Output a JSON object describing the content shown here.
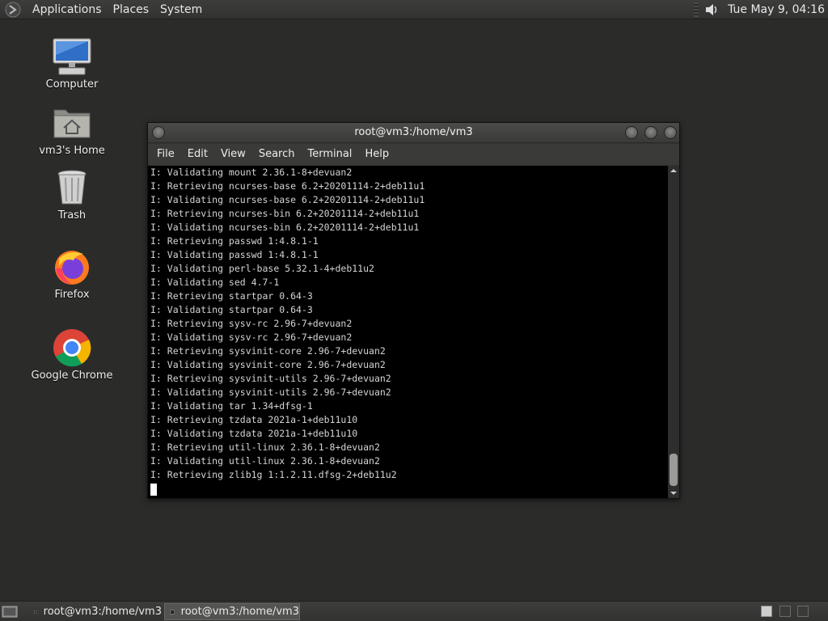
{
  "top_panel": {
    "menus": [
      "Applications",
      "Places",
      "System"
    ],
    "clock": "Tue May  9, 04:16"
  },
  "desktop": {
    "icons": [
      {
        "label": "Computer"
      },
      {
        "label": "vm3's Home"
      },
      {
        "label": "Trash"
      },
      {
        "label": "Firefox"
      },
      {
        "label": "Google Chrome"
      }
    ]
  },
  "terminal": {
    "title": "root@vm3:/home/vm3",
    "menu": [
      "File",
      "Edit",
      "View",
      "Search",
      "Terminal",
      "Help"
    ],
    "lines": [
      "I: Validating mount 2.36.1-8+devuan2",
      "I: Retrieving ncurses-base 6.2+20201114-2+deb11u1",
      "I: Validating ncurses-base 6.2+20201114-2+deb11u1",
      "I: Retrieving ncurses-bin 6.2+20201114-2+deb11u1",
      "I: Validating ncurses-bin 6.2+20201114-2+deb11u1",
      "I: Retrieving passwd 1:4.8.1-1",
      "I: Validating passwd 1:4.8.1-1",
      "I: Validating perl-base 5.32.1-4+deb11u2",
      "I: Validating sed 4.7-1",
      "I: Retrieving startpar 0.64-3",
      "I: Validating startpar 0.64-3",
      "I: Retrieving sysv-rc 2.96-7+devuan2",
      "I: Validating sysv-rc 2.96-7+devuan2",
      "I: Retrieving sysvinit-core 2.96-7+devuan2",
      "I: Validating sysvinit-core 2.96-7+devuan2",
      "I: Retrieving sysvinit-utils 2.96-7+devuan2",
      "I: Validating sysvinit-utils 2.96-7+devuan2",
      "I: Validating tar 1.34+dfsg-1",
      "I: Retrieving tzdata 2021a-1+deb11u10",
      "I: Validating tzdata 2021a-1+deb11u10",
      "I: Retrieving util-linux 2.36.1-8+devuan2",
      "I: Validating util-linux 2.36.1-8+devuan2",
      "I: Retrieving zlib1g 1:1.2.11.dfsg-2+deb11u2"
    ]
  },
  "taskbar": {
    "tasks": [
      {
        "label": "root@vm3:/home/vm3",
        "active": false
      },
      {
        "label": "root@vm3:/home/vm3",
        "active": true
      }
    ]
  }
}
